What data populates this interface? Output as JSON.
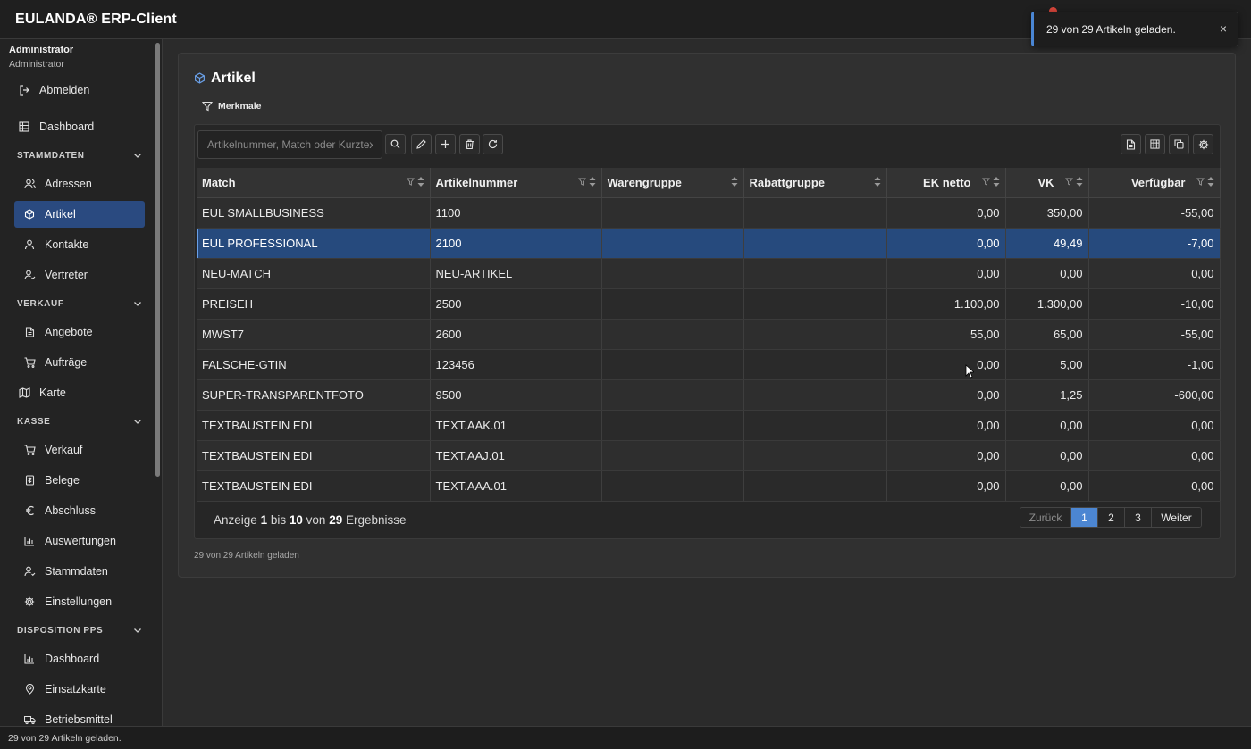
{
  "app": {
    "title": "EULANDA® ERP-Client"
  },
  "toast": {
    "text": "29 von 29 Artikeln geladen.",
    "close": "×"
  },
  "user": {
    "name": "Administrator",
    "role": "Administrator"
  },
  "sidebar": {
    "logout": "Abmelden",
    "dashboard": "Dashboard",
    "sections": {
      "stammdaten": "STAMMDATEN",
      "verkauf": "VERKAUF",
      "kasse": "KASSE",
      "disposition": "DISPOSITION PPS"
    },
    "items": {
      "adressen": "Adressen",
      "artikel": "Artikel",
      "kontakte": "Kontakte",
      "vertreter": "Vertreter",
      "angebote": "Angebote",
      "auftraege": "Aufträge",
      "karte": "Karte",
      "kasse_verkauf": "Verkauf",
      "belege": "Belege",
      "abschluss": "Abschluss",
      "auswertungen": "Auswertungen",
      "stammdaten": "Stammdaten",
      "einstellungen": "Einstellungen",
      "pps_dashboard": "Dashboard",
      "einsatzkarte": "Einsatzkarte",
      "betriebsmittel": "Betriebsmittel"
    }
  },
  "main": {
    "title": "Artikel",
    "filter_label": "Merkmale",
    "search_placeholder": "Artikelnummer, Match oder Kurztext",
    "columns": {
      "match": "Match",
      "artikelnummer": "Artikelnummer",
      "warengruppe": "Warengruppe",
      "rabattgruppe": "Rabattgruppe",
      "ek_netto": "EK netto",
      "vk": "VK",
      "verfuegbar": "Verfügbar"
    },
    "rows": [
      {
        "match": "EUL SMALLBUSINESS",
        "artikelnummer": "1100",
        "warengruppe": "",
        "rabattgruppe": "",
        "ek": "0,00",
        "vk": "350,00",
        "verfuegbar": "-55,00"
      },
      {
        "match": "EUL PROFESSIONAL",
        "artikelnummer": "2100",
        "warengruppe": "",
        "rabattgruppe": "",
        "ek": "0,00",
        "vk": "49,49",
        "verfuegbar": "-7,00"
      },
      {
        "match": "NEU-MATCH",
        "artikelnummer": "NEU-ARTIKEL",
        "warengruppe": "",
        "rabattgruppe": "",
        "ek": "0,00",
        "vk": "0,00",
        "verfuegbar": "0,00"
      },
      {
        "match": "PREISEH",
        "artikelnummer": "2500",
        "warengruppe": "",
        "rabattgruppe": "",
        "ek": "1.100,00",
        "vk": "1.300,00",
        "verfuegbar": "-10,00"
      },
      {
        "match": "MWST7",
        "artikelnummer": "2600",
        "warengruppe": "",
        "rabattgruppe": "",
        "ek": "55,00",
        "vk": "65,00",
        "verfuegbar": "-55,00"
      },
      {
        "match": "FALSCHE-GTIN",
        "artikelnummer": "123456",
        "warengruppe": "",
        "rabattgruppe": "",
        "ek": "0,00",
        "vk": "5,00",
        "verfuegbar": "-1,00"
      },
      {
        "match": "SUPER-TRANSPARENTFOTO",
        "artikelnummer": "9500",
        "warengruppe": "",
        "rabattgruppe": "",
        "ek": "0,00",
        "vk": "1,25",
        "verfuegbar": "-600,00"
      },
      {
        "match": "TEXTBAUSTEIN EDI",
        "artikelnummer": "TEXT.AAK.01",
        "warengruppe": "",
        "rabattgruppe": "",
        "ek": "0,00",
        "vk": "0,00",
        "verfuegbar": "0,00"
      },
      {
        "match": "TEXTBAUSTEIN EDI",
        "artikelnummer": "TEXT.AAJ.01",
        "warengruppe": "",
        "rabattgruppe": "",
        "ek": "0,00",
        "vk": "0,00",
        "verfuegbar": "0,00"
      },
      {
        "match": "TEXTBAUSTEIN EDI",
        "artikelnummer": "TEXT.AAA.01",
        "warengruppe": "",
        "rabattgruppe": "",
        "ek": "0,00",
        "vk": "0,00",
        "verfuegbar": "0,00"
      }
    ],
    "selected_row": 1,
    "footer": {
      "anzeige": "Anzeige",
      "from": "1",
      "bis": "bis",
      "to": "10",
      "von": "von",
      "total": "29",
      "ergebnisse": "Ergebnisse"
    },
    "pager": {
      "prev": "Zurück",
      "pages": [
        "1",
        "2",
        "3"
      ],
      "current": "1",
      "next": "Weiter"
    },
    "loaded_note": "29 von 29 Artikeln geladen"
  },
  "status_bar": {
    "text": "29 von 29 Artikeln geladen."
  },
  "colors": {
    "accent": "#4c86d2",
    "selected_row": "#264a7d",
    "sidebar_active": "#2a4a80",
    "notification": "#d9463b"
  }
}
